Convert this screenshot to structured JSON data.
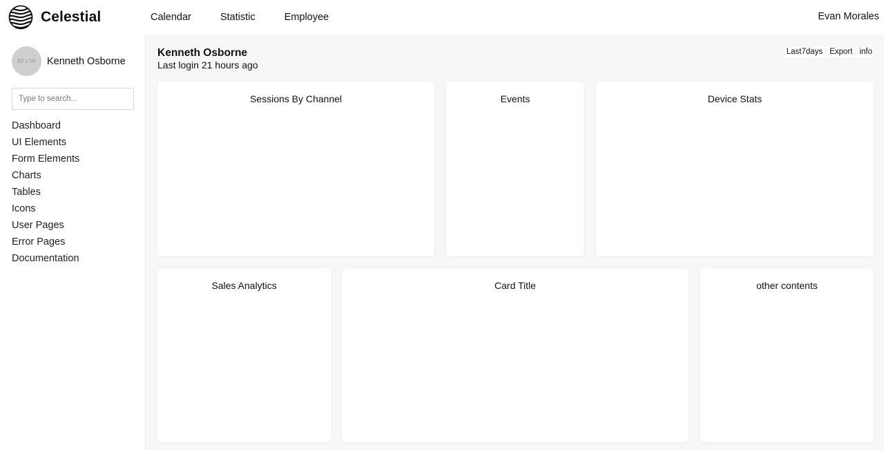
{
  "brand": {
    "name": "Celestial",
    "logo_icon": "wave-globe-icon"
  },
  "topnav": {
    "items": [
      "Calendar",
      "Statistic",
      "Employee"
    ]
  },
  "user": {
    "name": "Evan Morales"
  },
  "sidebar": {
    "profile": {
      "name": "Kenneth Osborne",
      "avatar_placeholder": "50 x 50"
    },
    "search": {
      "placeholder": "Type to search...",
      "value": ""
    },
    "menu": [
      "Dashboard",
      "UI Elements",
      "Form Elements",
      "Charts",
      "Tables",
      "Icons",
      "User Pages",
      "Error Pages",
      "Documentation"
    ]
  },
  "header": {
    "title": "Kenneth Osborne",
    "subtitle": "Last login 21 hours ago",
    "actions": [
      "Last7days",
      "Export",
      "info"
    ]
  },
  "cards": [
    "Sessions By Channel",
    "Events",
    "Device Stats",
    "Sales Analytics",
    "Card Title",
    "other contents"
  ],
  "colors": {
    "background": "#f7f7f7",
    "card": "#ffffff",
    "avatar": "#cfcfcf"
  }
}
